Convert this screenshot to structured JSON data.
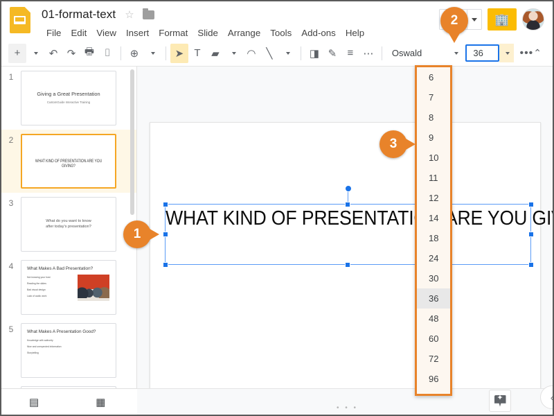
{
  "header": {
    "logo_icon": "slides-logo-icon",
    "doc_title": "01-format-text",
    "star_icon": "☆",
    "folder_icon": "folder-icon",
    "menus": [
      "File",
      "Edit",
      "View",
      "Insert",
      "Format",
      "Slide",
      "Arrange",
      "Tools",
      "Add-ons",
      "Help"
    ],
    "share_button_label": "",
    "present_icon": "🏢",
    "avatar_label": "user-avatar"
  },
  "toolbar": {
    "new_slide_icon": "+",
    "undo_icon": "↶",
    "redo_icon": "↷",
    "print_icon": "🖶",
    "paint_format_icon": "⌷",
    "zoom_icon": "⊕",
    "select_icon": "➤",
    "textbox_icon": "T",
    "image_icon": "▰",
    "shape_icon": "◠",
    "line_icon": "╲",
    "fill_icon": "◨",
    "pen_icon": "✎",
    "lineweight_icon": "≡",
    "linedash_icon": "⋯",
    "font_name": "Oswald",
    "font_size": "36",
    "more_icon": "•••",
    "collapse_icon": "⌃"
  },
  "thumbnails": [
    {
      "number": "1",
      "layout": "title",
      "title": "Giving a Great Presentation",
      "subtitle": "CustomGuide Interactive Training",
      "selected": false
    },
    {
      "number": "2",
      "layout": "caps",
      "title": "WHAT KIND OF PRESENTATION ARE YOU GIVING?",
      "subtitle": "",
      "selected": true
    },
    {
      "number": "3",
      "layout": "center-body",
      "title": "What do you want to know\nafter today's presentation?",
      "subtitle": "",
      "selected": false
    },
    {
      "number": "4",
      "layout": "bullets-photo",
      "title": "What Makes A Bad Presentation?",
      "bullets": [
        "Not knowing your host",
        "Reading the slides",
        "Bad visual design",
        "Lack of audio work"
      ],
      "selected": false
    },
    {
      "number": "5",
      "layout": "bullets",
      "title": "What Makes A Presentation Good?",
      "bullets": [
        "Knowledge with authority",
        "Nice and unexpected information",
        "Storytelling"
      ],
      "selected": false
    }
  ],
  "thumb_bottombar": {
    "filmstrip_icon": "▤",
    "grid_icon": "▦"
  },
  "slide": {
    "text": "WHAT KIND OF PRESENTATION ARE YOU GIVING?"
  },
  "canvas_bottom": {
    "grip_icon": "• • •",
    "explore_icon": "explore-icon",
    "sidepanel_toggle_icon": "‹"
  },
  "font_size_dropdown": {
    "options": [
      "6",
      "7",
      "8",
      "9",
      "10",
      "11",
      "12",
      "14",
      "18",
      "24",
      "30",
      "36",
      "48",
      "60",
      "72",
      "96"
    ],
    "selected": "36"
  },
  "markers": [
    {
      "label": "1",
      "dir": "right"
    },
    {
      "label": "2",
      "dir": "down"
    },
    {
      "label": "3",
      "dir": "right"
    }
  ],
  "colors": {
    "marker_orange": "#e8832a",
    "selection_blue": "#1a73e8",
    "thumb_selected_border": "#f5a623",
    "present_yellow": "#fbbc04",
    "dropdown_bg": "#fdf7f0"
  }
}
